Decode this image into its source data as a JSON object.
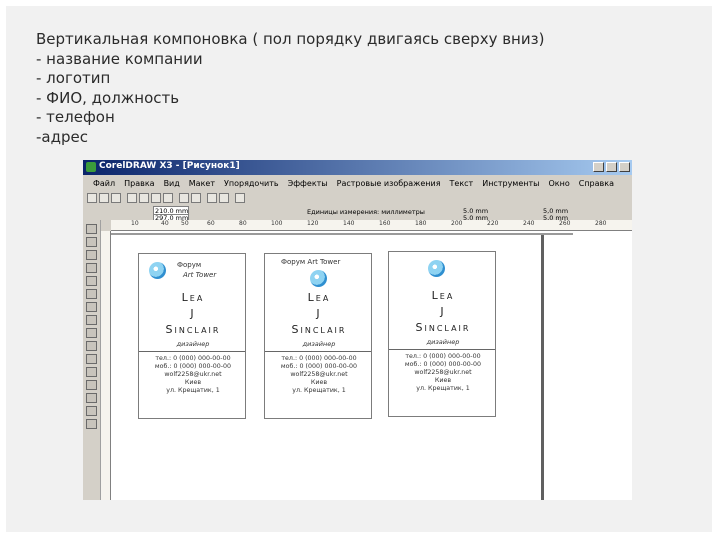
{
  "slide": {
    "lines": [
      "Вертикальная компоновка ( пол порядку двигаясь сверху вниз)",
      "- название компании",
      "- логотип",
      "- ФИО, должность",
      "- телефон",
      "-адрес"
    ]
  },
  "window": {
    "title": "CorelDRAW X3 - [Рисунок1]",
    "menu": [
      "Файл",
      "Правка",
      "Вид",
      "Макет",
      "Упорядочить",
      "Эффекты",
      "Растровые изображения",
      "Текст",
      "Инструменты",
      "Окно",
      "Справка"
    ]
  },
  "property_bar": {
    "width": "210.0 mm",
    "height": "297.0 mm",
    "units": "Единицы измерения: миллиметры",
    "nudge1": "5.0 mm",
    "nudge2": "5.0 mm",
    "zoom_x": "5,0 mm",
    "zoom_y": "5,0 mm"
  },
  "ruler": {
    "ticks": [
      "10",
      "40",
      "50",
      "60",
      "80",
      "100",
      "120",
      "140",
      "160",
      "180",
      "200",
      "220",
      "240",
      "260",
      "280"
    ]
  },
  "cards": [
    {
      "company": "Форум",
      "company_line2": "Art Tower",
      "name_first": "Lea",
      "name_middle": "J",
      "name_last": "Sinclair",
      "position": "дизайнер",
      "contacts": [
        "тел.: 0 (000) 000-00-00",
        "моб.: 0 (000) 000-00-00",
        "wolf2258@ukr.net",
        "Киев",
        "ул. Крещатик, 1"
      ]
    },
    {
      "company": "Форум Art Tower",
      "name_first": "Lea",
      "name_middle": "J",
      "name_last": "Sinclair",
      "position": "дизайнер",
      "contacts": [
        "тел.: 0 (000) 000-00-00",
        "моб.: 0 (000) 000-00-00",
        "wolf2258@ukr.net",
        "Киев",
        "ул. Крещатик, 1"
      ]
    },
    {
      "name_first": "Lea",
      "name_middle": "J",
      "name_last": "Sinclair",
      "position": "дизайнер",
      "contacts": [
        "тел.: 0 (000) 000-00-00",
        "моб.: 0 (000) 000-00-00",
        "wolf2258@ukr.net",
        "Киев",
        "ул. Крещатик, 1"
      ]
    }
  ]
}
